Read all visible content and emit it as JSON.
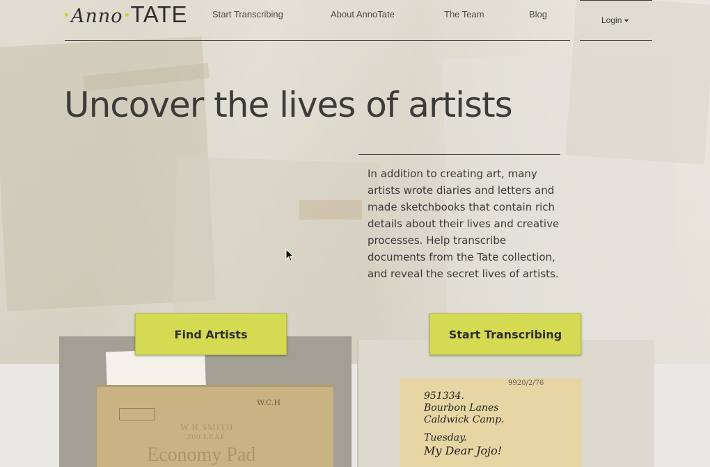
{
  "header": {
    "logo_anno": "Anno",
    "logo_tate": "TATE",
    "nav": [
      {
        "label": "Start Transcribing"
      },
      {
        "label": "About AnnoTate"
      },
      {
        "label": "The Team"
      },
      {
        "label": "Blog"
      }
    ],
    "login_label": "Login"
  },
  "hero": {
    "title": "Uncover the lives of artists",
    "description": "In addition to creating art, many artists wrote diaries and letters and made sketchbooks that contain rich details about their lives and creative processes. Help transcribe documents from the Tate collection, and reveal the secret lives of artists.",
    "find_artists_label": "Find Artists",
    "start_transcribing_label": "Start Transcribing"
  },
  "photo": {
    "notebook_brand": "W.H.SMITH",
    "notebook_sub": "200 LEAF",
    "notebook_title": "Economy Pad",
    "notebook_initials": "W.C.H",
    "archive_number": "9920/2/76",
    "letter_lines": [
      "951334.",
      "Bourbon Lanes",
      "Caldwick Camp.",
      "Tuesday.",
      "My Dear Jojo!"
    ]
  },
  "colors": {
    "button": "#d4db52",
    "logo_accent": "#cbd133",
    "text": "#3a3a38"
  }
}
